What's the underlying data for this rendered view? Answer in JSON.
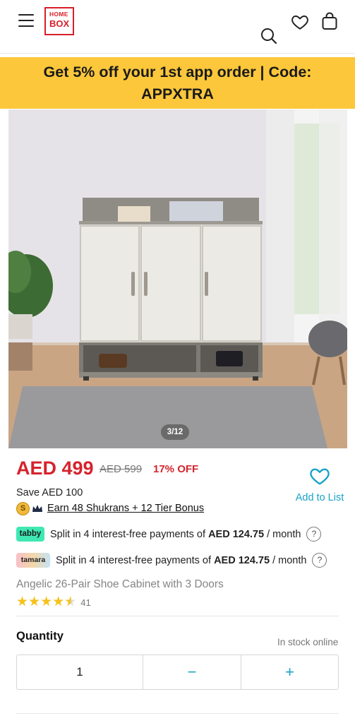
{
  "header": {
    "logo_line1": "HOME",
    "logo_line2": "BOX",
    "icons": [
      "menu-icon",
      "search-icon",
      "heart-icon",
      "bag-icon"
    ]
  },
  "promo": {
    "line1": "Get 5% off your 1st app order | Code:",
    "line2": "APPXTRA"
  },
  "gallery": {
    "counter": "3/12"
  },
  "price": {
    "current": "AED 499",
    "old": "AED 599",
    "discount": "17% OFF",
    "save": "Save AED 100"
  },
  "wishlist": {
    "label": "Add to List"
  },
  "shukran": {
    "coin_letter": "S",
    "text": "Earn 48 Shukrans +  12 Tier Bonus"
  },
  "installments": [
    {
      "brand": "tabby",
      "prefix": "Split in 4 interest-free payments of ",
      "amount": "AED 124.75",
      "suffix": " / month",
      "help": "?"
    },
    {
      "brand": "tamara",
      "prefix": "Split in 4 interest-free payments of ",
      "amount": "AED 124.75",
      "suffix": " / month",
      "help": "?"
    }
  ],
  "product": {
    "title": "Angelic 26-Pair Shoe Cabinet with 3 Doors",
    "rating": 4.5,
    "rating_count": "41"
  },
  "quantity": {
    "label": "Quantity",
    "stock": "In stock online",
    "value": "1",
    "minus": "−",
    "plus": "+"
  },
  "colors": {
    "brand_red": "#d5232d",
    "promo_yellow": "#fcc73a",
    "accent_blue": "#1aa3c7",
    "tabby_green": "#3fe8b3",
    "star_yellow": "#f4c21d"
  }
}
